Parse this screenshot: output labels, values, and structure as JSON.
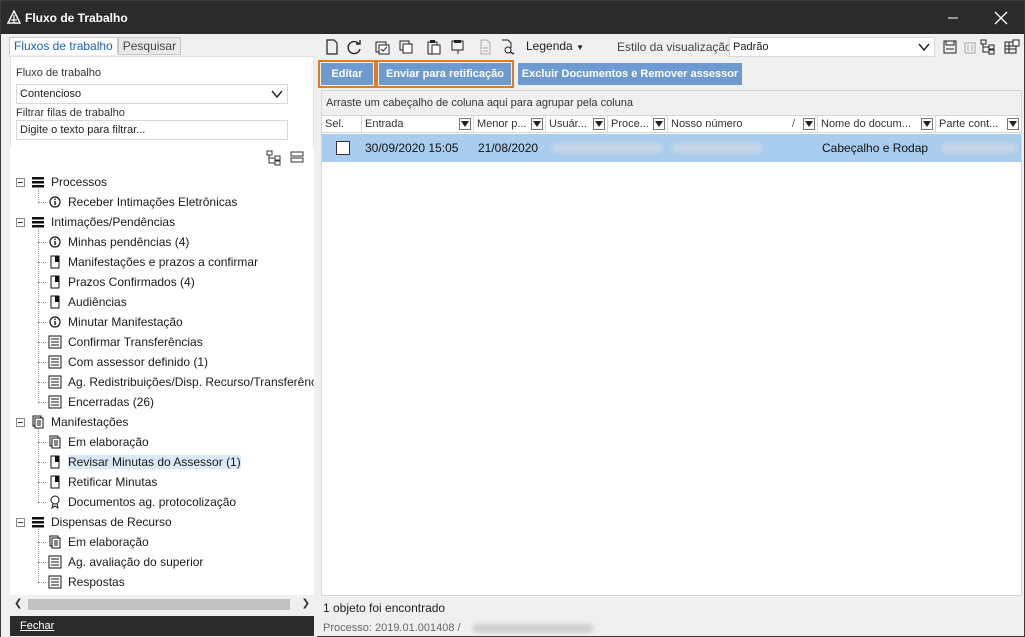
{
  "window": {
    "title": "Fluxo de Trabalho"
  },
  "left": {
    "tabs": [
      {
        "label": "Fluxos de trabalho",
        "active": true
      },
      {
        "label": "Pesquisar",
        "active": false
      }
    ],
    "workflow_label": "Fluxo de trabalho",
    "workflow_value": "Contencioso",
    "filter_label": "Filtrar filas de trabalho",
    "filter_placeholder": "Digite o texto para filtrar...",
    "close_label": "Fechar"
  },
  "tree": [
    {
      "label": "Processos",
      "level": 0,
      "icon": "stack-icon"
    },
    {
      "label": "Receber Intimações Eletrônicas",
      "level": 1,
      "icon": "info-icon"
    },
    {
      "label": "Intimações/Pendências",
      "level": 0,
      "icon": "stack-icon"
    },
    {
      "label": "Minhas pendências (4)",
      "level": 1,
      "icon": "info-icon"
    },
    {
      "label": "Manifestações e prazos a confirmar",
      "level": 1,
      "icon": "flag-document-icon"
    },
    {
      "label": "Prazos Confirmados (4)",
      "level": 1,
      "icon": "flag-document-icon"
    },
    {
      "label": "Audiências",
      "level": 1,
      "icon": "flag-document-icon"
    },
    {
      "label": "Minutar Manifestação",
      "level": 1,
      "icon": "info-icon"
    },
    {
      "label": "Confirmar Transferências",
      "level": 1,
      "icon": "form-icon"
    },
    {
      "label": "Com assessor definido (1)",
      "level": 1,
      "icon": "form-icon"
    },
    {
      "label": "Ag. Redistribuições/Disp. Recurso/Transferênc",
      "level": 1,
      "icon": "form-icon"
    },
    {
      "label": "Encerradas (26)",
      "level": 1,
      "icon": "form-icon"
    },
    {
      "label": "Manifestações",
      "level": 0,
      "icon": "documents-icon"
    },
    {
      "label": "Em elaboração",
      "level": 1,
      "icon": "documents-icon"
    },
    {
      "label": "Revisar Minutas do Assessor (1)",
      "level": 1,
      "icon": "flag-document-icon",
      "selected": true
    },
    {
      "label": "Retificar Minutas",
      "level": 1,
      "icon": "flag-document-icon"
    },
    {
      "label": "Documentos ag. protocolização",
      "level": 1,
      "icon": "stamp-icon"
    },
    {
      "label": "Dispensas de Recurso",
      "level": 0,
      "icon": "stack-icon"
    },
    {
      "label": "Em elaboração",
      "level": 1,
      "icon": "documents-icon"
    },
    {
      "label": "Ag. avaliação do superior",
      "level": 1,
      "icon": "form-icon"
    },
    {
      "label": "Respostas",
      "level": 1,
      "icon": "form-icon"
    }
  ],
  "toolbar": {
    "legend_label": "Legenda",
    "style_label": "Estilo da visualização",
    "style_value": "Padrão"
  },
  "actions": {
    "edit": "Editar",
    "send": "Enviar para retificação",
    "delete": "Excluir Documentos e Remover assessor"
  },
  "grid": {
    "group_hint": "Arraste um cabeçalho de coluna aqui para agrupar pela coluna",
    "columns": [
      "Sel.",
      "Entrada",
      "Menor p...",
      "Usuár...",
      "Proce...",
      "Nosso número",
      "Nome do docum...",
      "Parte cont..."
    ],
    "sort_indicator": "/",
    "row": {
      "entrada": "30/09/2020 15:05",
      "menor_prazo": "21/08/2020",
      "nome_documento": "Cabeçalho e Rodap"
    }
  },
  "status": {
    "count": "1 objeto foi encontrado",
    "process": "Processo: 2019.01.001408 /"
  },
  "colors": {
    "titlebar": "#2b2b2b",
    "action_button": "#6d9bd1",
    "highlight": "#e07b1f",
    "selected_row": "#a9cdee"
  }
}
